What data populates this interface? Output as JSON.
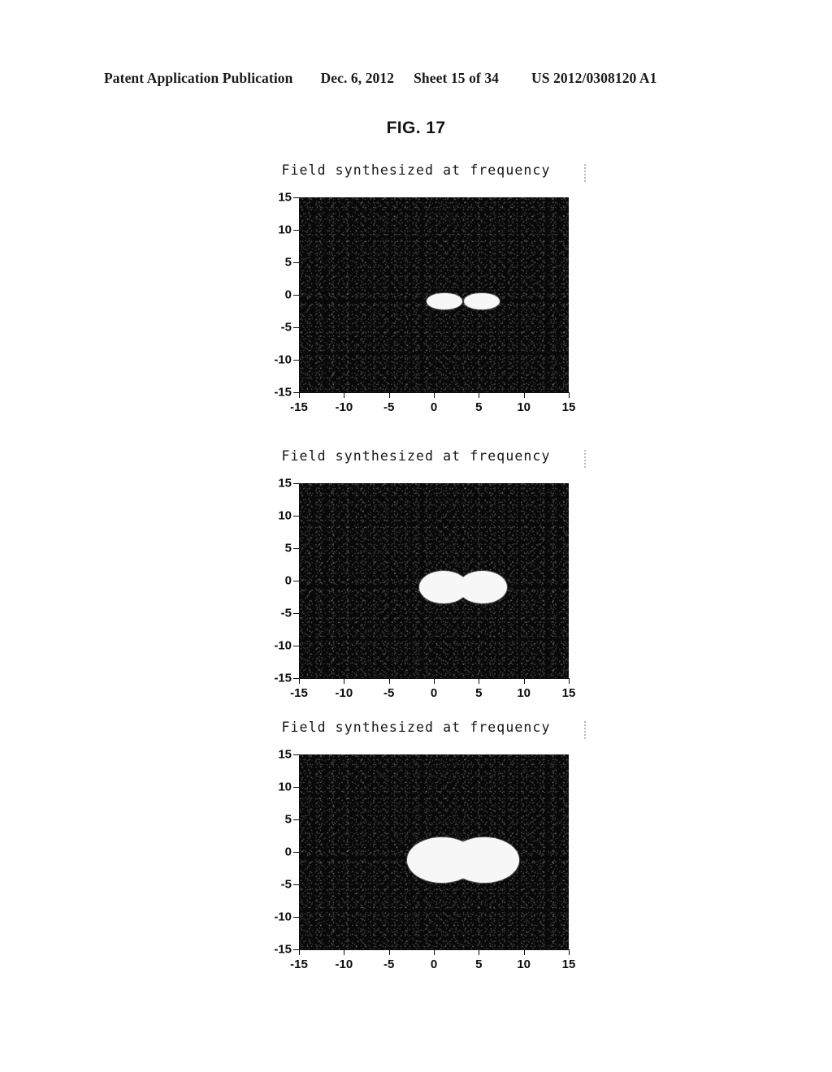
{
  "header": {
    "publication": "Patent Application Publication",
    "date": "Dec. 6, 2012",
    "sheet": "Sheet 15 of 34",
    "pub_number": "US 2012/0308120 A1"
  },
  "figure": {
    "label": "FIG. 17"
  },
  "chart_data": [
    {
      "type": "heatmap",
      "title": "Field synthesized at frequency",
      "xlabel": "",
      "ylabel": "",
      "xlim": [
        -15,
        15
      ],
      "ylim": [
        -15,
        15
      ],
      "xticks": [
        "-15",
        "-10",
        "-5",
        "0",
        "5",
        "10",
        "15"
      ],
      "xtick_values": [
        -15,
        -10,
        -5,
        0,
        5,
        10,
        15
      ],
      "yticks": [
        "15",
        "10",
        "5",
        "0",
        "-5",
        "-10",
        "-15"
      ],
      "ytick_values": [
        15,
        10,
        5,
        0,
        -5,
        -10,
        -15
      ],
      "grid": false,
      "legend": null,
      "background": "#050505",
      "foreground": "#f7f7f7",
      "features": [
        {
          "shape": "ring",
          "cx": 1.2,
          "cy": -1.0,
          "rx": 2.0,
          "ry": 1.3,
          "core_rx": 1.45,
          "core_ry": 0.65
        },
        {
          "shape": "ring",
          "cx": 5.3,
          "cy": -1.0,
          "rx": 2.0,
          "ry": 1.3,
          "core_rx": 1.45,
          "core_ry": 0.65
        }
      ]
    },
    {
      "type": "heatmap",
      "title": "Field synthesized at frequency",
      "xlabel": "",
      "ylabel": "",
      "xlim": [
        -15,
        15
      ],
      "ylim": [
        -15,
        15
      ],
      "xticks": [
        "-15",
        "-10",
        "-5",
        "0",
        "5",
        "10",
        "15"
      ],
      "xtick_values": [
        -15,
        -10,
        -5,
        0,
        5,
        10,
        15
      ],
      "yticks": [
        "15",
        "10",
        "5",
        "0",
        "-5",
        "-10",
        "-15"
      ],
      "ytick_values": [
        15,
        10,
        5,
        0,
        -5,
        -10,
        -15
      ],
      "grid": false,
      "legend": null,
      "background": "#050505",
      "foreground": "#f7f7f7",
      "features": [
        {
          "shape": "ring",
          "cx": 1.1,
          "cy": -1.0,
          "rx": 2.7,
          "ry": 2.5,
          "core_rx": 1.7,
          "core_ry": 0.75
        },
        {
          "shape": "ring",
          "cx": 5.4,
          "cy": -1.0,
          "rx": 2.7,
          "ry": 2.5,
          "core_rx": 1.7,
          "core_ry": 0.75
        }
      ]
    },
    {
      "type": "heatmap",
      "title": "Field synthesized at frequency",
      "xlabel": "",
      "ylabel": "",
      "xlim": [
        -15,
        15
      ],
      "ylim": [
        -15,
        15
      ],
      "xticks": [
        "-15",
        "-10",
        "-5",
        "0",
        "5",
        "10",
        "15"
      ],
      "xtick_values": [
        -15,
        -10,
        -5,
        0,
        5,
        10,
        15
      ],
      "yticks": [
        "15",
        "10",
        "5",
        "0",
        "-5",
        "-10",
        "-15"
      ],
      "ytick_values": [
        15,
        10,
        5,
        0,
        -5,
        -10,
        -15
      ],
      "grid": false,
      "legend": null,
      "background": "#050505",
      "foreground": "#f7f7f7",
      "features": [
        {
          "shape": "ring",
          "cx": 0.9,
          "cy": -1.2,
          "rx": 3.9,
          "ry": 3.5,
          "core_rx": 1.9,
          "core_ry": 0.95
        },
        {
          "shape": "ring",
          "cx": 5.6,
          "cy": -1.2,
          "rx": 3.9,
          "ry": 3.5,
          "core_rx": 1.9,
          "core_ry": 0.95
        }
      ]
    }
  ]
}
